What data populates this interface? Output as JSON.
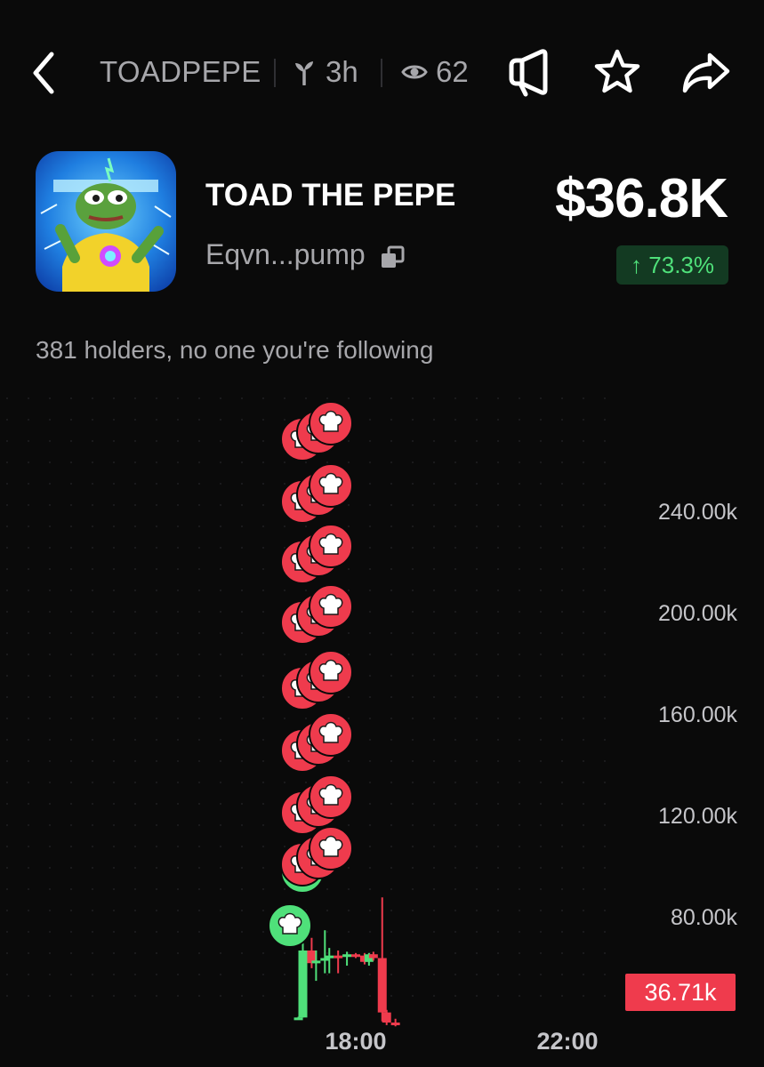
{
  "header": {
    "ticker": "TOADPEPE",
    "age": "3h",
    "views": "62",
    "actions": [
      "back-icon",
      "megaphone-icon",
      "star-icon",
      "share-icon"
    ]
  },
  "token": {
    "name": "TOAD THE PEPE",
    "address": "Eqvn...pump",
    "market_cap": "$36.8K",
    "change": "↑ 73.3%",
    "holders_text": "381 holders, no one you're following"
  },
  "colors": {
    "background": "#0a0a0a",
    "up": "#4fe07a",
    "down": "#ef3b4d",
    "muted_text": "#a7a7ab"
  },
  "chart_data": {
    "type": "candlestick",
    "y_ticks": [
      "240.00k",
      "200.00k",
      "160.00k",
      "120.00k",
      "80.00k"
    ],
    "x_ticks": [
      "18:00",
      "22:00"
    ],
    "current_price_label": "36.71k",
    "grid": "dotted",
    "candles": [
      {
        "time": "16:55",
        "open": 40.0,
        "high": 40.8,
        "low": 40.0,
        "close": 40.5
      },
      {
        "time": "17:00",
        "open": 40.5,
        "high": 70.0,
        "low": 40.5,
        "close": 67.0
      },
      {
        "time": "17:10",
        "open": 67.0,
        "high": 72.0,
        "low": 60.0,
        "close": 62.0
      },
      {
        "time": "17:15",
        "open": 62.0,
        "high": 67.0,
        "low": 55.0,
        "close": 63.0
      },
      {
        "time": "17:25",
        "open": 63.0,
        "high": 75.0,
        "low": 58.0,
        "close": 64.0
      },
      {
        "time": "17:30",
        "open": 64.0,
        "high": 68.0,
        "low": 58.0,
        "close": 65.0
      },
      {
        "time": "17:40",
        "open": 65.0,
        "high": 67.0,
        "low": 58.0,
        "close": 64.5
      },
      {
        "time": "17:50",
        "open": 64.5,
        "high": 66.5,
        "low": 61.0,
        "close": 65.5
      },
      {
        "time": "18:00",
        "open": 65.5,
        "high": 66.0,
        "low": 64.0,
        "close": 65.0
      },
      {
        "time": "18:10",
        "open": 65.0,
        "high": 66.0,
        "low": 61.5,
        "close": 62.5
      },
      {
        "time": "18:15",
        "open": 62.5,
        "high": 66.0,
        "low": 61.0,
        "close": 65.5
      },
      {
        "time": "18:20",
        "open": 65.5,
        "high": 66.5,
        "low": 63.0,
        "close": 64.0
      },
      {
        "time": "18:30",
        "open": 64.0,
        "high": 88.0,
        "low": 39.0,
        "close": 42.5
      },
      {
        "time": "18:35",
        "open": 42.5,
        "high": 43.5,
        "low": 37.5,
        "close": 38.5
      },
      {
        "time": "18:45",
        "open": 38.5,
        "high": 40.0,
        "low": 37.0,
        "close": 37.5
      }
    ],
    "markers": {
      "icon": "chef-hat-icon",
      "buy_count": 2,
      "sell_rows": 8
    }
  }
}
